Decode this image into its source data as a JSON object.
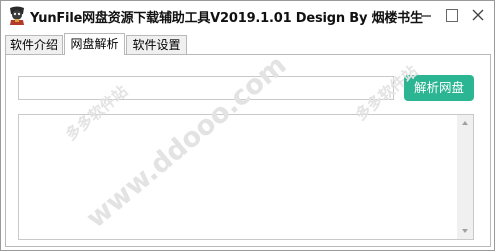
{
  "window": {
    "title": "YunFile网盘资源下载辅助工具V2019.1.01  Design By 烟楼书生"
  },
  "title_buttons": {
    "minimize": "minimize-icon",
    "maximize": "maximize-icon",
    "close": "close-icon"
  },
  "tabs": [
    {
      "label": "软件介绍",
      "active": false
    },
    {
      "label": "网盘解析",
      "active": true
    },
    {
      "label": "软件设置",
      "active": false
    }
  ],
  "parse_panel": {
    "url_value": "",
    "url_placeholder": "",
    "parse_button_label": "解析网盘",
    "output_value": ""
  },
  "watermark": {
    "cn_text": "多多软件站",
    "url_text": "www.ddooo.com"
  },
  "colors": {
    "accent_button": "#2bb592",
    "watermark": "#e3e3e3"
  }
}
